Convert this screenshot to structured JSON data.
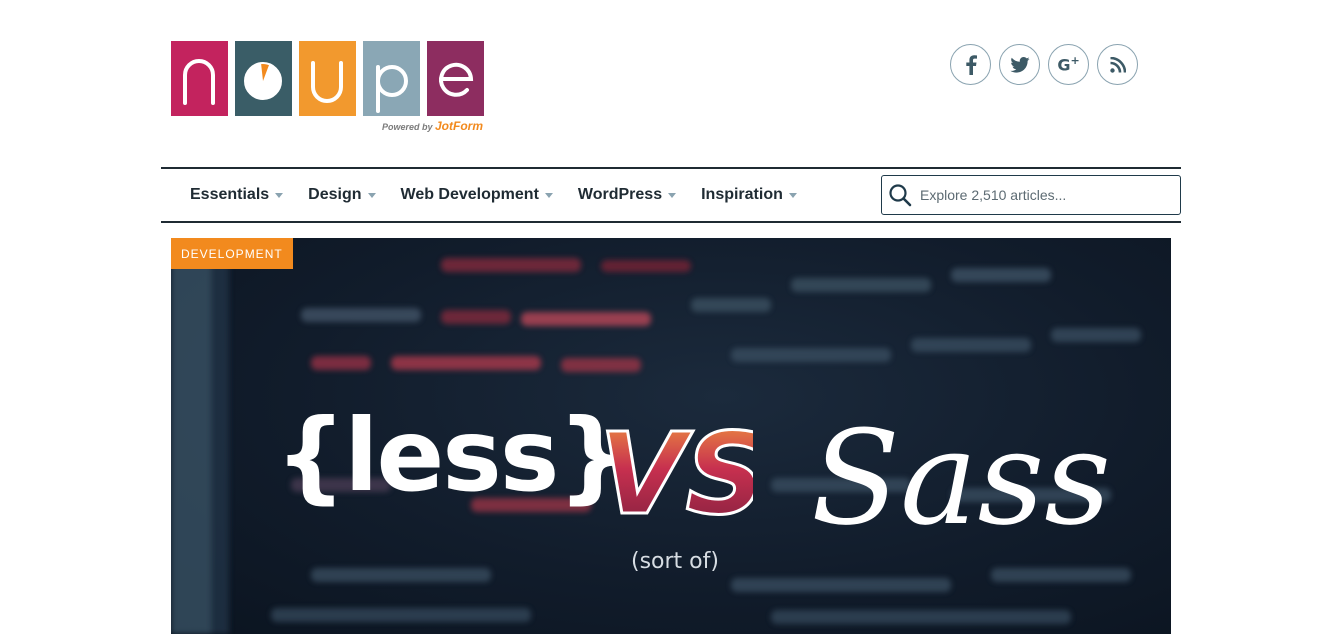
{
  "logo": {
    "letters": [
      "n",
      "o",
      "u",
      "p",
      "e"
    ],
    "tile_colors": [
      "#c3235e",
      "#3a5d67",
      "#f2992e",
      "#8aa7b5",
      "#8d2d60"
    ],
    "powered_by": "Powered by",
    "powered_brand": "JotForm"
  },
  "social": [
    {
      "icon": "facebook-icon",
      "glyph": "f"
    },
    {
      "icon": "twitter-icon",
      "glyph": "🐦"
    },
    {
      "icon": "google-plus-icon",
      "glyph": "G+"
    },
    {
      "icon": "rss-icon",
      "glyph": "rss"
    }
  ],
  "nav": {
    "items": [
      {
        "label": "Essentials"
      },
      {
        "label": "Design"
      },
      {
        "label": "Web Development"
      },
      {
        "label": "WordPress"
      },
      {
        "label": "Inspiration"
      }
    ],
    "search_placeholder": "Explore 2,510 articles..."
  },
  "hero": {
    "category": "DEVELOPMENT",
    "left_text": "{less}",
    "vs_text": "VS",
    "sub_text": "(sort of)",
    "right_text": "Sass"
  },
  "colors": {
    "accent": "#f28a1e",
    "nav_text": "#1f2b33",
    "nav_border": "#1f2b33",
    "caret": "#8aa3b0",
    "hero_bg": "#111c2b"
  }
}
